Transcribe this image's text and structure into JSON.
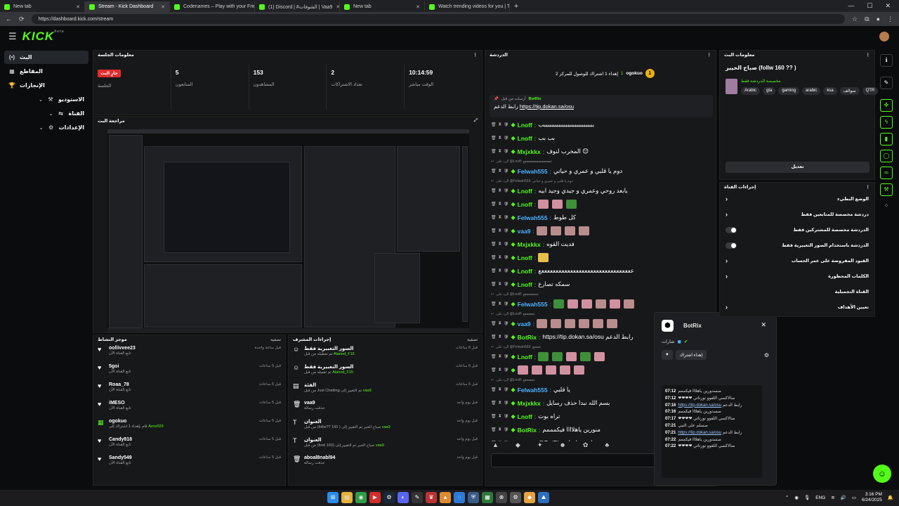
{
  "browser": {
    "tabs": [
      {
        "label": "New tab",
        "active": false
      },
      {
        "label": "Stream - Kick Dashboard",
        "active": true
      },
      {
        "label": "Codenames – Play with your Frien",
        "active": false
      },
      {
        "label": "(1) Discord | #الشوفات | Vaa9",
        "active": false
      },
      {
        "label": "New tab",
        "active": false
      },
      {
        "label": "Watch trending videos for you | T",
        "active": false
      }
    ],
    "url": "https://dashboard.kick.com/stream"
  },
  "app": {
    "logo": "KICK",
    "logo_sup": "beta"
  },
  "sidebar": {
    "items": [
      {
        "label": "البث",
        "icon": "live-icon",
        "glyph": "(•)"
      },
      {
        "label": "المقاطع",
        "icon": "clips-icon",
        "glyph": "▦"
      },
      {
        "label": "الإنجازات",
        "icon": "trophy-icon",
        "glyph": "🏆"
      },
      {
        "label": "الاستوديو",
        "icon": "studio-icon",
        "glyph": "⚒"
      },
      {
        "label": "القناة",
        "icon": "channel-icon",
        "glyph": "⇆"
      },
      {
        "label": "الإعدادات",
        "icon": "gear-icon",
        "glyph": "⚙"
      }
    ]
  },
  "session": {
    "title": "معلومات الجلسة",
    "live_badge": "جارٍ البث",
    "cols": [
      {
        "value": "",
        "label": "الجلسة"
      },
      {
        "value": "5",
        "label": "المتابعون"
      },
      {
        "value": "153",
        "label": "المشاهدون"
      },
      {
        "value": "2",
        "label": "تعداد الاشتراكات"
      },
      {
        "value": "10:14:59",
        "label": "الوقت مباشر"
      }
    ]
  },
  "preview": {
    "title": "مراجعة البث"
  },
  "feeds": {
    "title": "موجز النشاط",
    "filter": "تصفية",
    "items": [
      {
        "name": "oollivvee23",
        "sub": "تابع القناة الآن",
        "time": "قبل ساعة واحدة",
        "icon": "heart-icon"
      },
      {
        "name": "5goi",
        "sub": "تابع القناة الآن",
        "time": "قبل 5 ساعات",
        "icon": "heart-icon"
      },
      {
        "name": "Roaa_78",
        "sub": "تابع القناة الآن",
        "time": "قبل 5 ساعات",
        "icon": "heart-icon"
      },
      {
        "name": "iMESO",
        "sub": "تابع القناة الآن",
        "time": "قبل 5 ساعات",
        "icon": "heart-icon"
      },
      {
        "name": "ogokuo",
        "sub": "قام بإهداء 1 اشتراك إلى",
        "sub_user": "Azoz029",
        "time": "قبل 5 ساعات",
        "icon": "gift-icon"
      },
      {
        "name": "Candy818",
        "sub": "تابع القناة الآن",
        "time": "قبل 5 ساعات",
        "icon": "heart-icon"
      },
      {
        "name": "Sandy549",
        "sub": "تابع القناة الآن",
        "time": "قبل 5 ساعات",
        "icon": "heart-icon"
      }
    ]
  },
  "modactions": {
    "title": "إجراءات المشرف",
    "filter": "تصفية",
    "items": [
      {
        "name": "السور التعبيرية فقط",
        "sub": "تم تعطيله من قبل",
        "sub_user": "Alanod_F15",
        "time": "قبل 6 ساعات",
        "icon": "emote-icon"
      },
      {
        "name": "السور التعبيرية فقط",
        "sub": "تم تفعيله من قبل",
        "sub_user": "Alanod_F15",
        "time": "قبل 6 ساعات",
        "icon": "emote-icon"
      },
      {
        "name": "الفئة",
        "sub": "من قبل Just Chatting تم التغيير إلى",
        "sub_user": "vaa9",
        "time": "قبل 6 ساعات",
        "icon": "category-icon"
      },
      {
        "name": "vaa9",
        "sub": "حذفت رسالة",
        "sub_user": "",
        "time": "قبل يوم واحد",
        "icon": "trash-icon"
      },
      {
        "name": "العنوان",
        "sub": "من قبل (follw?? 160 ) صباح الخير تم التغيير إلى",
        "sub_user": "vaa9",
        "time": "قبل يوم واحد",
        "icon": "title-icon"
      },
      {
        "name": "العنوان",
        "sub": "من قبل (fowl 160) صباح الخير تم التغيير إلى",
        "sub_user": "vaa9",
        "time": "قبل يوم واحد",
        "icon": "title-icon"
      },
      {
        "name": "aboal8nabl94",
        "sub": "حذفت رسالة",
        "sub_user": "",
        "time": "قبل يوم واحد",
        "icon": "trash-icon"
      }
    ]
  },
  "chat": {
    "title": "الدردشة",
    "goal_user": "ogokuo",
    "goal_count": "1",
    "goal_text": "إهداء 1 اشتراك للوصول للمركز 2",
    "pinned_label": "أرسلت من قبل",
    "pinned_user": "BotRix",
    "pinned_text": "رابط الدعم",
    "pinned_link": "https://tip.dokan.sa/osu",
    "messages": [
      {
        "user": "Lnoff",
        "color": "#53fc18",
        "text": "ببببببببببببببببببببببببببببب"
      },
      {
        "user": "Lnoff",
        "color": "#53fc18",
        "text": "بب بب"
      },
      {
        "user": "Mxjxkkx",
        "color": "#53fc18",
        "text": "المخرب لنوف 😊"
      },
      {
        "reply": "الرد على @Lnoff: ععععععععععععععععع"
      },
      {
        "user": "Felwah555",
        "color": "#4ab4ff",
        "text": "دوم يا قلبي و عمري و حياتي"
      },
      {
        "reply": "الرد على @Felwah555: دوم يا قلبي و عمري و حياتي"
      },
      {
        "user": "Lnoff",
        "color": "#53fc18",
        "text": "يابعد روحي وعمري و جيدي وجيد ابيه"
      },
      {
        "user": "Lnoff",
        "color": "#53fc18",
        "text": "",
        "emotes": [
          "p",
          "p",
          "g"
        ]
      },
      {
        "user": "Felwah555",
        "color": "#4ab4ff",
        "text": "كل طوط"
      },
      {
        "user": "vaa9",
        "color": "#4ab4ff",
        "text": "",
        "emotes": [
          "",
          "",
          "",
          ""
        ]
      },
      {
        "user": "Mxjxkkx",
        "color": "#53fc18",
        "text": "فديت القوه"
      },
      {
        "user": "Lnoff",
        "color": "#53fc18",
        "text": "",
        "emotes": [
          "y"
        ]
      },
      {
        "user": "Lnoff",
        "color": "#53fc18",
        "text": "ععععععععععععععععععععععععععععععععع"
      },
      {
        "user": "Lnoff",
        "color": "#53fc18",
        "text": "سمكه تصارع"
      },
      {
        "reply": "الرد على @Lnoff: ععععععععع"
      },
      {
        "user": "Felwah555",
        "color": "#4ab4ff",
        "text": "",
        "emotes": [
          "g",
          "p",
          "p",
          "",
          "p",
          ""
        ]
      },
      {
        "reply": "الرد على @Lnoff: ععععععع"
      },
      {
        "user": "vaa9",
        "color": "#4ab4ff",
        "text": "",
        "emotes": [
          "",
          "",
          "",
          "",
          "",
          ""
        ]
      },
      {
        "user": "BotRix",
        "color": "#53fc18",
        "text": "https://tip.dokan.sa/osu رابط الدعم"
      },
      {
        "reply": "الرد على @Felwah555: ععععع"
      },
      {
        "user": "Lnoff",
        "color": "#53fc18",
        "text": "",
        "emotes": [
          "g",
          "g",
          "p",
          "g",
          "p"
        ]
      },
      {
        "user": "",
        "color": "#53fc18",
        "text": "",
        "emotes": [
          "p",
          "p",
          "p",
          "p",
          "p"
        ]
      },
      {
        "reply": "الرد على @Lnoff: ععععععع"
      },
      {
        "user": "Felwah555",
        "color": "#4ab4ff",
        "text": "يا قلبي"
      },
      {
        "user": "Mxjxkkx",
        "color": "#53fc18",
        "text": "بسم الله نبدا حذف رسايل"
      },
      {
        "user": "Lnoff",
        "color": "#53fc18",
        "text": "تراه بوت"
      },
      {
        "user": "BotRix",
        "color": "#53fc18",
        "text": "منورين ياهلاااا فيكمممم"
      },
      {
        "user": "Lnoff",
        "color": "#53fc18",
        "text": "@BotRix يابوت ياسلبه"
      }
    ]
  },
  "popup": {
    "name": "BotRix",
    "label": "شارات",
    "sub_button": "إهداء اشتراك",
    "log": [
      {
        "time": "07:12",
        "text": "صسدورين ياهلااا فيكممم"
      },
      {
        "time": "07:12",
        "text": "❤❤❤❤ صالاكسي اللفوو نورتاتي"
      },
      {
        "time": "07:16",
        "text": "رابط الدعم",
        "link": "https://tip.dokan.sa/osu"
      },
      {
        "time": "07:16",
        "text": "صسدورين ياهلااا فيكممم"
      },
      {
        "time": "07:17",
        "text": "❤❤❤❤ صالاكسي اللفوو نورتاتي"
      },
      {
        "time": "07:21",
        "text": "صسلم على النبي"
      },
      {
        "time": "07:21",
        "text": "رابط الدعم",
        "link": "https://tip.dokan.sa/osu"
      },
      {
        "time": "07:22",
        "text": "صسدورين ياهلااا فيكممم"
      },
      {
        "time": "07:22",
        "text": "❤❤❤❤ صالاكسي اللفوو نورتاتي"
      }
    ]
  },
  "info": {
    "header": "معلومات البث",
    "title": "صباح الخيير (follw 160 ?? )",
    "category": "مخصصة للدردشة فقط",
    "tags": [
      "Arabic",
      "gta",
      "gaming",
      "arabic",
      "ksa",
      "سوالف",
      "QTR"
    ],
    "edit": "تعديل"
  },
  "actions": {
    "header": "إجراءات القناة",
    "rows": [
      {
        "label": "الوضع البطيء",
        "control": "chevron"
      },
      {
        "label": "دردشة مخصصة للمتابعين فقط",
        "control": "chevron"
      },
      {
        "label": "الدردشة مخصصة للمشتركين فقط",
        "control": "toggle"
      },
      {
        "label": "الدردشة باستخدام الصور التعبيرية فقط",
        "control": "toggle"
      },
      {
        "label": "القيود المفروضة على عمر الحساب",
        "control": "chevron"
      },
      {
        "label": "الكلمات المحظورة",
        "control": "chevron"
      },
      {
        "label": "القناة التجميلية",
        "control": "none"
      },
      {
        "label": "تعيين الأهداف",
        "control": "chevron"
      }
    ]
  },
  "taskbar": {
    "lang": "ENG",
    "time": "3:16 PM",
    "date": "6/24/2025"
  },
  "colors": {
    "accent": "#53fc18",
    "live": "#e32c2c"
  }
}
